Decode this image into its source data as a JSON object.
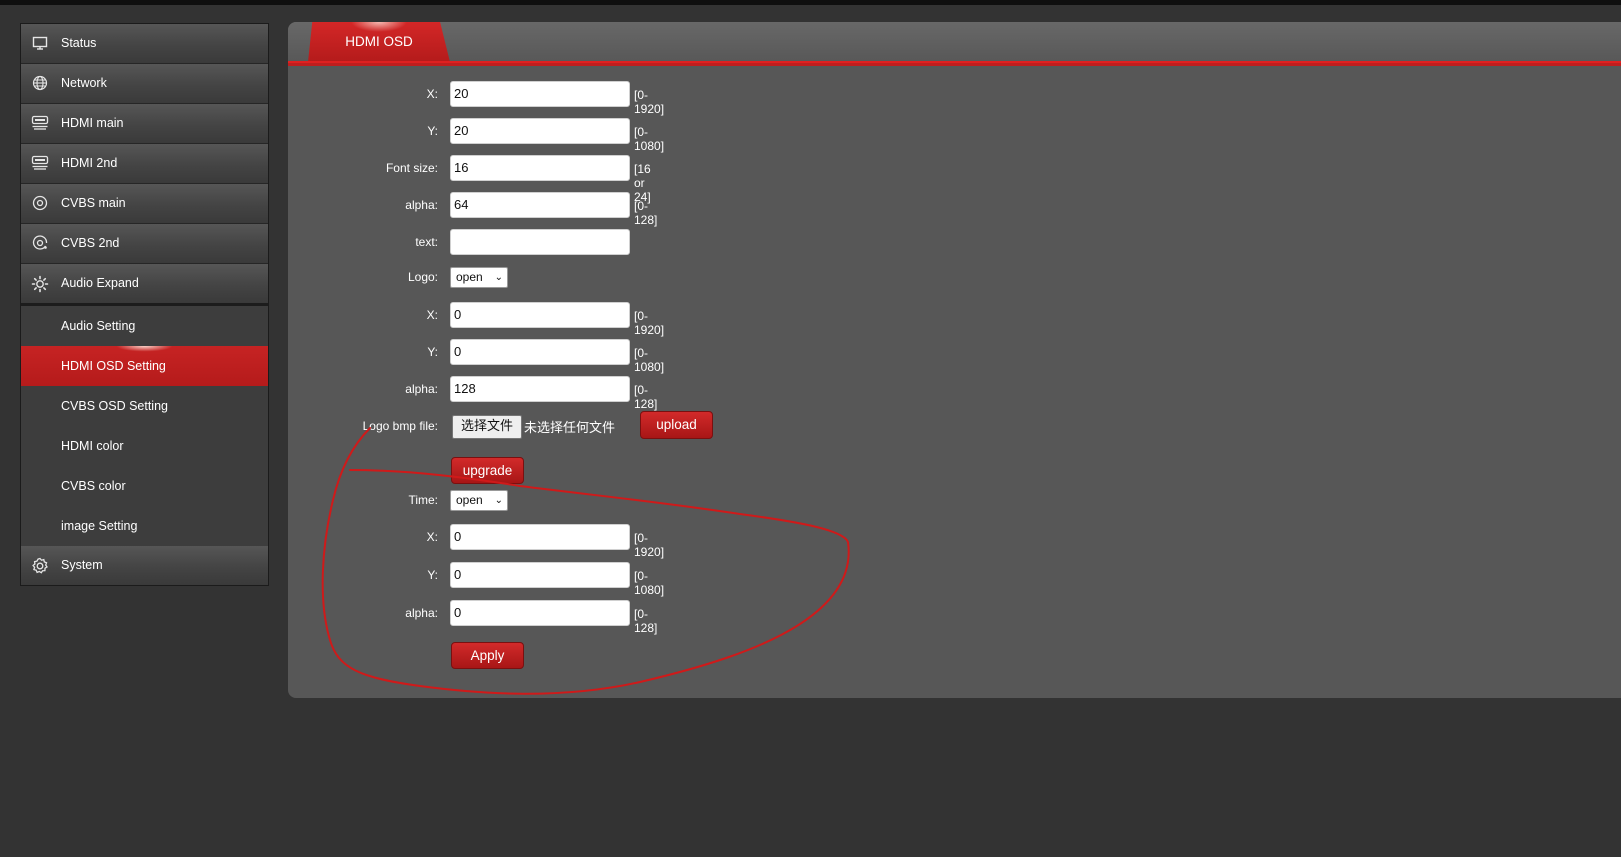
{
  "sidebar": {
    "items": [
      {
        "label": "Status",
        "icon": "monitor-icon"
      },
      {
        "label": "Network",
        "icon": "globe-icon"
      },
      {
        "label": "HDMI main",
        "icon": "hdmi-icon"
      },
      {
        "label": "HDMI 2nd",
        "icon": "hdmi-icon"
      },
      {
        "label": "CVBS main",
        "icon": "cvbs-icon"
      },
      {
        "label": "CVBS 2nd",
        "icon": "cvbs-icon"
      },
      {
        "label": "Audio Expand",
        "icon": "gear-sun-icon"
      }
    ],
    "sub_items": [
      {
        "label": "Audio Setting"
      },
      {
        "label": "HDMI OSD Setting",
        "active": true
      },
      {
        "label": "CVBS OSD Setting"
      },
      {
        "label": "HDMI color"
      },
      {
        "label": "CVBS color"
      },
      {
        "label": "image Setting"
      }
    ],
    "system": {
      "label": "System",
      "icon": "gear-icon"
    }
  },
  "tab": {
    "label": "HDMI OSD"
  },
  "form": {
    "text_x": {
      "label": "X:",
      "value": "20",
      "hint": "[0-1920]"
    },
    "text_y": {
      "label": "Y:",
      "value": "20",
      "hint": "[0-1080]"
    },
    "font_size": {
      "label": "Font size:",
      "value": "16",
      "hint": "[16 or 24]"
    },
    "text_alpha": {
      "label": "alpha:",
      "value": "64",
      "hint": "[0-128]"
    },
    "text": {
      "label": "text:",
      "value": ""
    },
    "logo": {
      "label": "Logo:",
      "value": "open"
    },
    "logo_x": {
      "label": "X:",
      "value": "0",
      "hint": "[0-1920]"
    },
    "logo_y": {
      "label": "Y:",
      "value": "0",
      "hint": "[0-1080]"
    },
    "logo_alpha": {
      "label": "alpha:",
      "value": "128",
      "hint": "[0-128]"
    },
    "logo_file": {
      "label": "Logo bmp file:",
      "button": "选择文件",
      "status": "未选择任何文件",
      "upload": "upload"
    },
    "upgrade": "upgrade",
    "time": {
      "label": "Time:",
      "value": "open"
    },
    "time_x": {
      "label": "X:",
      "value": "0",
      "hint": "[0-1920]"
    },
    "time_y": {
      "label": "Y:",
      "value": "0",
      "hint": "[0-1080]"
    },
    "time_alpha": {
      "label": "alpha:",
      "value": "0",
      "hint": "[0-128]"
    },
    "apply": "Apply"
  },
  "colors": {
    "accent": "#bf1e1e",
    "annotation": "#d01818"
  }
}
